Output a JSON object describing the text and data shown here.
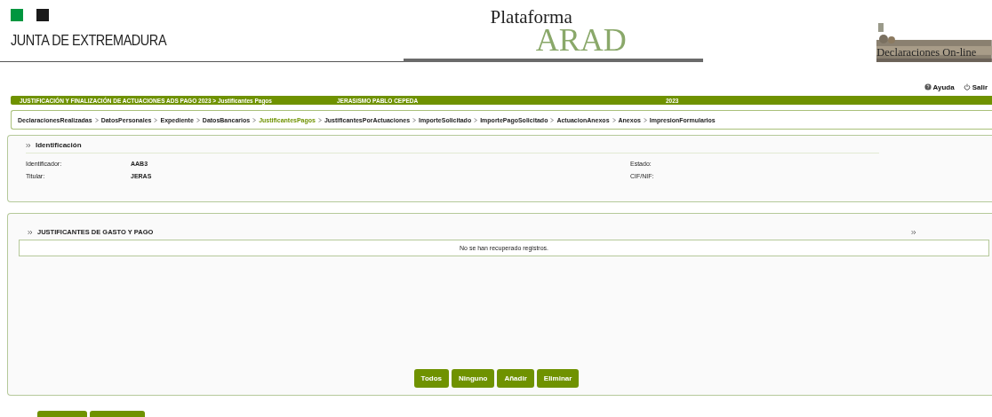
{
  "header": {
    "org_name": "JUNTA DE EXTREMADURA",
    "platform_line1": "Plataforma",
    "platform_line2": "ARAD",
    "banner_text": "Declaraciones On-line"
  },
  "top_links": [
    {
      "kind": "help",
      "label": "Ayuda"
    },
    {
      "kind": "exit",
      "label": "Salir"
    }
  ],
  "title_bar": {
    "title": "JUSTIFICACIÓN Y FINALIZACIÓN DE ACTUACIONES ADS PAGO 2023 > Justificantes Pagos",
    "holder": "JERASISMO PABLO CEPEDA",
    "year": "2023"
  },
  "breadcrumb": [
    {
      "label": "DeclaracionesRealizadas",
      "selected": false
    },
    {
      "label": "DatosPersonales",
      "selected": false
    },
    {
      "label": "Expediente",
      "selected": false
    },
    {
      "label": "DatosBancarios",
      "selected": false
    },
    {
      "label": "JustificantesPagos",
      "selected": true
    },
    {
      "label": "JustificantesPorActuaciones",
      "selected": false
    },
    {
      "label": "ImporteSolicitado",
      "selected": false
    },
    {
      "label": "ImportePagoSolicitado",
      "selected": false
    },
    {
      "label": "ActuacionAnexos",
      "selected": false
    },
    {
      "label": "Anexos",
      "selected": false
    },
    {
      "label": "ImpresionFormularios",
      "selected": false
    }
  ],
  "identification": {
    "title": "Identificación",
    "fields": [
      {
        "label": "Identificador:",
        "value": "AAB3"
      },
      {
        "label": "Estado:"
      },
      {
        "label": "Titular:",
        "value": "JERAS"
      },
      {
        "label": "CIF/NIF:"
      }
    ]
  },
  "receipts": {
    "title": "JUSTIFICANTES DE GASTO Y PAGO",
    "empty_message": "No se han recuperado registros.",
    "buttons": [
      "Todos",
      "Ninguno",
      "Añadir",
      "Eliminar"
    ]
  }
}
